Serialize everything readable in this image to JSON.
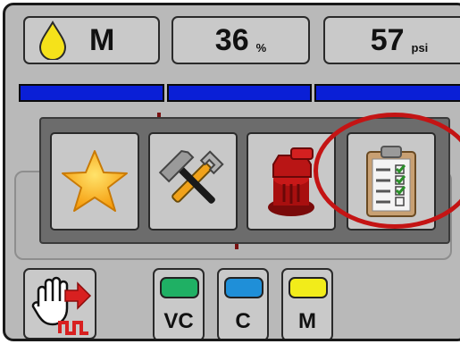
{
  "header": {
    "mode_value": "M",
    "percent_value": "36",
    "percent_unit": "%",
    "pressure_value": "57",
    "pressure_unit": "psi"
  },
  "status_bars": {
    "color": "#0a1fd6",
    "count": 3
  },
  "menu": {
    "items": [
      {
        "icon": "star-icon"
      },
      {
        "icon": "tools-icon"
      },
      {
        "icon": "spray-nozzle-icon"
      },
      {
        "icon": "checklist-icon"
      }
    ],
    "highlight_color": "#c41414"
  },
  "bottom": {
    "control_icon": "hand-stop-icon",
    "swatches": [
      {
        "label": "VC",
        "color": "#1fb064"
      },
      {
        "label": "C",
        "color": "#1f8fd8"
      },
      {
        "label": "M",
        "color": "#f2ec1a"
      }
    ]
  }
}
